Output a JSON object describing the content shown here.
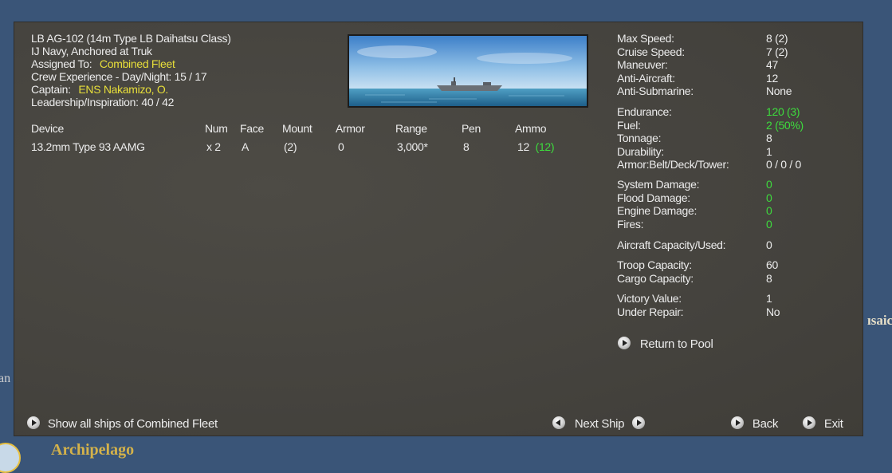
{
  "background": {
    "map_labels": {
      "archipelago": "Archipelago",
      "right_fragment": "ısaic",
      "left_fragment": "an"
    },
    "colors": {
      "ocean": "#3a5578",
      "panel": "#474540",
      "label": "#d4b24a"
    }
  },
  "ship": {
    "name": "LB AG-102 (14m Type LB Daihatsu Class)",
    "status": "IJ Navy, Anchored at Truk",
    "assigned_label": "Assigned To:",
    "assigned_value": "Combined Fleet",
    "crew_experience": "Crew Experience - Day/Night: 15 / 17",
    "captain_label": "Captain:",
    "captain_value": "ENS Nakamizo, O.",
    "leadership": "Leadership/Inspiration: 40 / 42"
  },
  "devices": {
    "headers": {
      "device": "Device",
      "num": "Num",
      "face": "Face",
      "mount": "Mount",
      "armor": "Armor",
      "range": "Range",
      "pen": "Pen",
      "ammo": "Ammo"
    },
    "rows": [
      {
        "device": "13.2mm Type 93 AAMG",
        "num": "x 2",
        "face": "A",
        "mount": "(2)",
        "armor": "0",
        "range": "3,000*",
        "pen": "8",
        "ammo": "12",
        "ammo_max": "(12)"
      }
    ]
  },
  "stats": {
    "speed": [
      {
        "label": "Max Speed:",
        "value": "8 (2)"
      },
      {
        "label": "Cruise Speed:",
        "value": "7 (2)"
      },
      {
        "label": "Maneuver:",
        "value": "47"
      },
      {
        "label": "Anti-Aircraft:",
        "value": "12"
      },
      {
        "label": "Anti-Submarine:",
        "value": "None"
      }
    ],
    "endurance": [
      {
        "label": "Endurance:",
        "value": "120 (3)",
        "color": "green"
      },
      {
        "label": "Fuel:",
        "value": "2 (50%)",
        "color": "green"
      },
      {
        "label": "Tonnage:",
        "value": "8"
      },
      {
        "label": "Durability:",
        "value": "1"
      },
      {
        "label": "Armor:Belt/Deck/Tower:",
        "value": "0 / 0 / 0"
      }
    ],
    "damage": [
      {
        "label": "System Damage:",
        "value": "0"
      },
      {
        "label": "Flood Damage:",
        "value": "0"
      },
      {
        "label": "Engine Damage:",
        "value": "0"
      },
      {
        "label": "Fires:",
        "value": "0"
      }
    ],
    "aircraft": {
      "label": "Aircraft Capacity/Used:",
      "value": "0"
    },
    "capacity": [
      {
        "label": "Troop Capacity:",
        "value": "60"
      },
      {
        "label": "Cargo Capacity:",
        "value": "8"
      }
    ],
    "victory": [
      {
        "label": "Victory Value:",
        "value": "1"
      },
      {
        "label": "Under Repair:",
        "value": "No"
      }
    ]
  },
  "actions": {
    "return_pool": "Return to Pool",
    "show_all": "Show all ships of Combined Fleet",
    "next_ship": "Next Ship",
    "back": "Back",
    "exit": "Exit"
  }
}
